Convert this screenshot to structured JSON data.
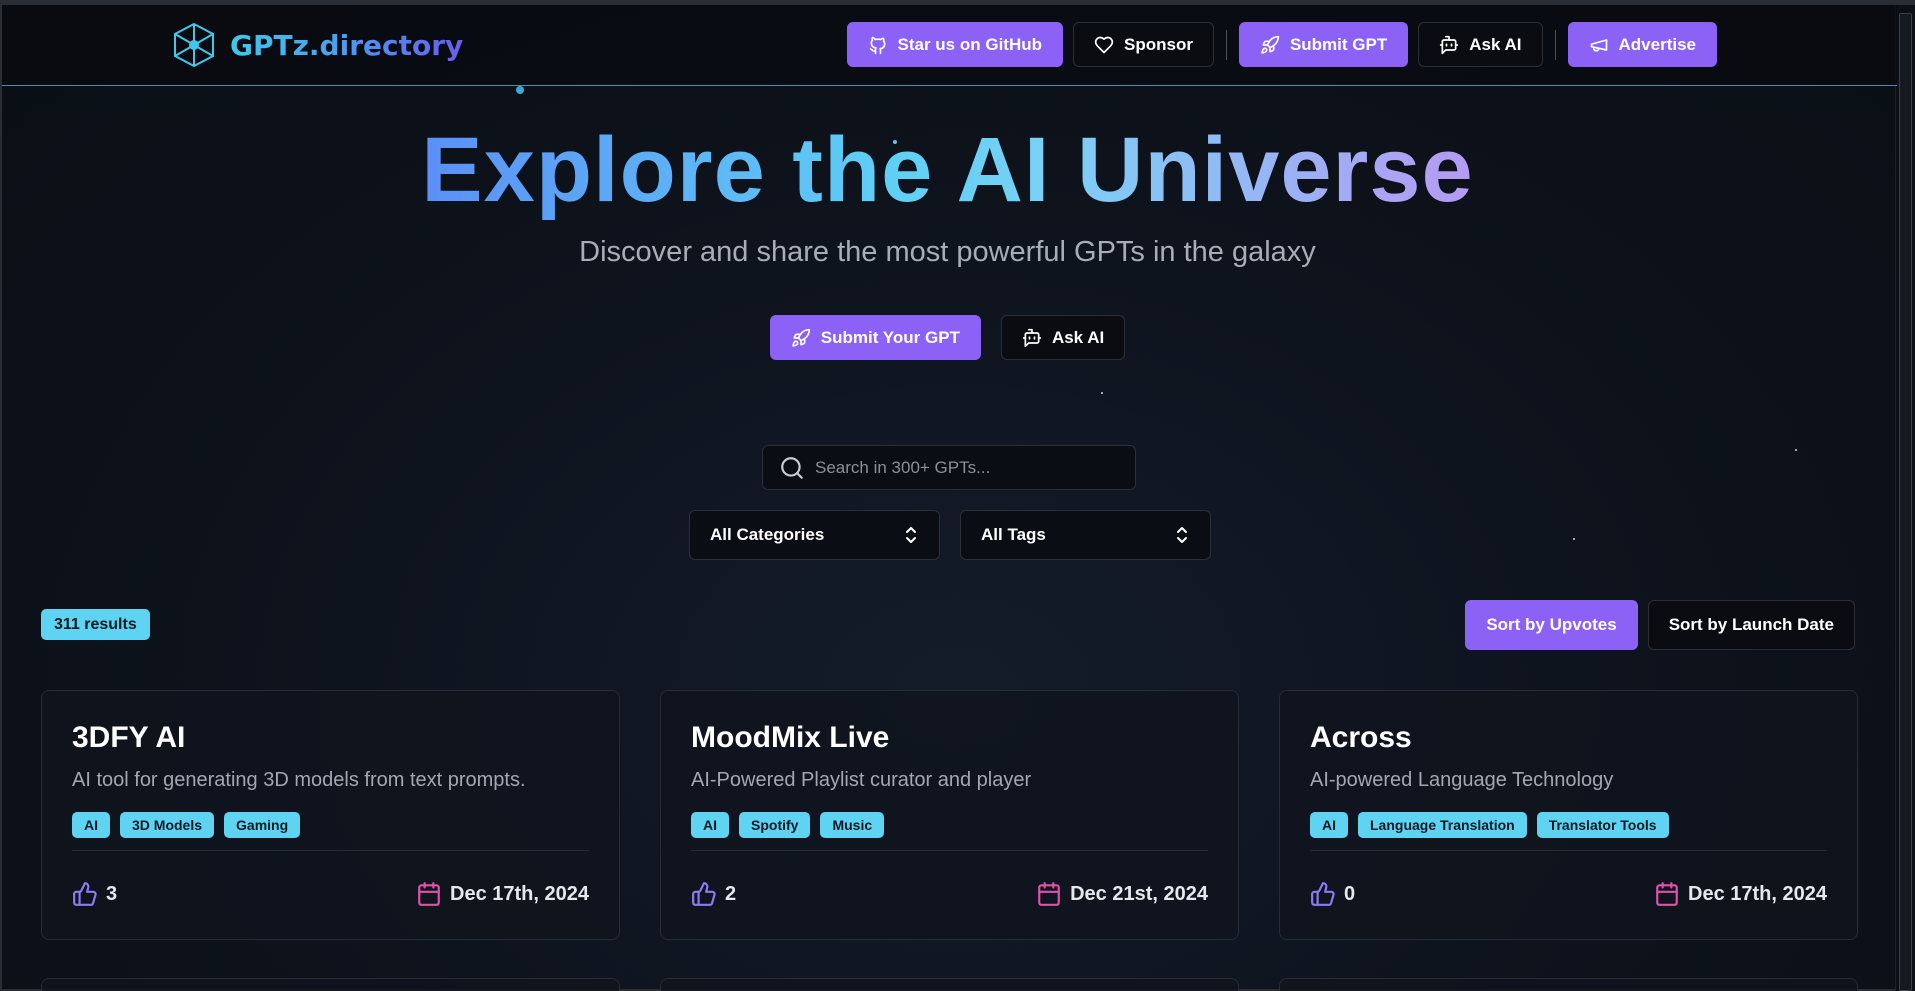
{
  "header": {
    "logo_prefix": "GPTz.",
    "logo_suffix": "directory",
    "nav": [
      {
        "label": "Star us on GitHub",
        "style": "primary",
        "icon": "github-icon"
      },
      {
        "label": "Sponsor",
        "style": "outline",
        "icon": "heart-icon"
      },
      {
        "label": "Submit GPT",
        "style": "primary",
        "icon": "rocket-icon"
      },
      {
        "label": "Ask AI",
        "style": "outline",
        "icon": "bot-icon"
      },
      {
        "label": "Advertise",
        "style": "primary",
        "icon": "megaphone-icon"
      }
    ]
  },
  "hero": {
    "title": "Explore the AI Universe",
    "subtitle": "Discover and share the most powerful GPTs in the galaxy",
    "submit_label": "Submit Your GPT",
    "ask_label": "Ask AI"
  },
  "search": {
    "placeholder": "Search in 300+ GPTs...",
    "value": ""
  },
  "filters": {
    "category": "All Categories",
    "tag": "All Tags"
  },
  "results": {
    "count_label": "311 results",
    "sort_upvotes": "Sort by Upvotes",
    "sort_date": "Sort by Launch Date",
    "active_sort": "upvotes"
  },
  "cards": [
    {
      "title": "3DFY AI",
      "desc": "AI tool for generating 3D models from text prompts.",
      "tags": [
        "AI",
        "3D Models",
        "Gaming"
      ],
      "upvotes": "3",
      "date": "Dec 17th, 2024"
    },
    {
      "title": "MoodMix Live",
      "desc": "AI-Powered Playlist curator and player",
      "tags": [
        "AI",
        "Spotify",
        "Music"
      ],
      "upvotes": "2",
      "date": "Dec 21st, 2024"
    },
    {
      "title": "Across",
      "desc": "AI-powered Language Technology",
      "tags": [
        "AI",
        "Language Translation",
        "Translator Tools"
      ],
      "upvotes": "0",
      "date": "Dec 17th, 2024"
    }
  ],
  "colors": {
    "accent": "#8b62f5",
    "tag": "#5fd4f2",
    "date_icon": "#e052a8",
    "upvote_icon": "#8b7cf5"
  }
}
